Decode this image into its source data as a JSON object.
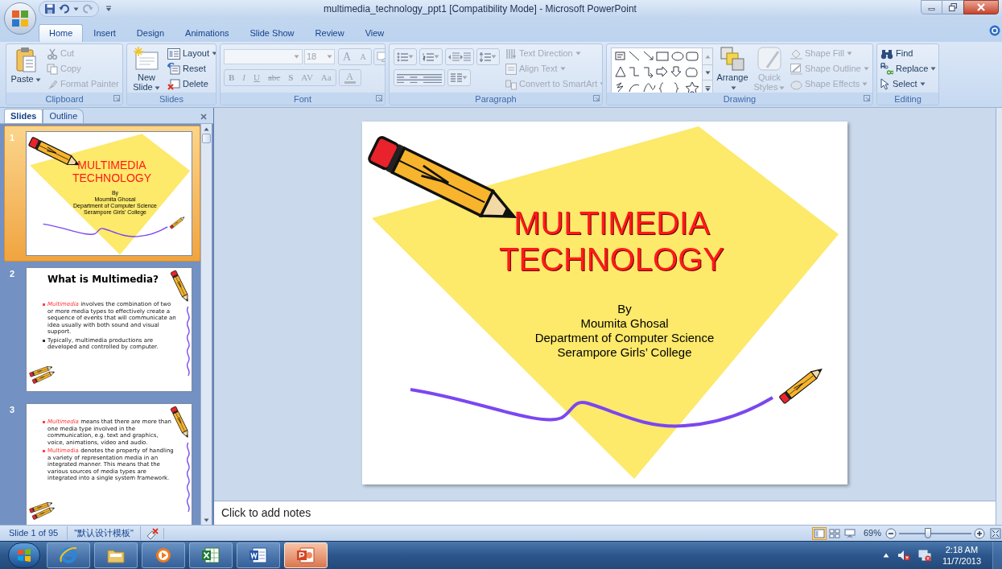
{
  "window": {
    "title": "multimedia_technology_ppt1 [Compatibility Mode] - Microsoft PowerPoint"
  },
  "tabs": [
    {
      "label": "Home",
      "selected": true
    },
    {
      "label": "Insert",
      "selected": false
    },
    {
      "label": "Design",
      "selected": false
    },
    {
      "label": "Animations",
      "selected": false
    },
    {
      "label": "Slide Show",
      "selected": false
    },
    {
      "label": "Review",
      "selected": false
    },
    {
      "label": "View",
      "selected": false
    }
  ],
  "ribbon": [
    {
      "name": "Clipboard",
      "launcher": true,
      "items": [
        {
          "kind": "large",
          "label": "Paste",
          "dropdown": true,
          "disabled": false
        },
        {
          "kind": "small",
          "label": "Cut",
          "dropdown": false,
          "disabled": true
        },
        {
          "kind": "small",
          "label": "Copy",
          "dropdown": false,
          "disabled": true
        },
        {
          "kind": "small",
          "label": "Format Painter",
          "dropdown": false,
          "disabled": true
        }
      ]
    },
    {
      "name": "Slides",
      "launcher": false,
      "items": [
        {
          "kind": "large",
          "label": "New Slide",
          "dropdown": true,
          "disabled": false
        },
        {
          "kind": "small",
          "label": "Layout",
          "dropdown": true,
          "disabled": false
        },
        {
          "kind": "small",
          "label": "Reset",
          "dropdown": false,
          "disabled": false
        },
        {
          "kind": "small",
          "label": "Delete",
          "dropdown": false,
          "disabled": false
        }
      ]
    },
    {
      "name": "Font",
      "launcher": true,
      "items": [
        {
          "kind": "font",
          "disabled": true,
          "size": "18",
          "grow": "A",
          "shrink": "A",
          "styles": [
            "B",
            "I",
            "U",
            "abc",
            "S",
            "AV",
            "Aa"
          ],
          "color_button": "A"
        }
      ]
    },
    {
      "name": "Paragraph",
      "launcher": true,
      "items": [
        {
          "kind": "icon_grid"
        },
        {
          "kind": "small",
          "label": "Text Direction",
          "dropdown": true,
          "disabled": true
        },
        {
          "kind": "small",
          "label": "Align Text",
          "dropdown": true,
          "disabled": true
        },
        {
          "kind": "small",
          "label": "Convert to SmartArt",
          "dropdown": true,
          "disabled": true
        }
      ]
    },
    {
      "name": "Drawing",
      "launcher": true,
      "items": [
        {
          "kind": "shape_gallery"
        },
        {
          "kind": "large",
          "label": "Arrange",
          "dropdown": true,
          "disabled": false
        },
        {
          "kind": "large",
          "label": "Quick Styles",
          "dropdown": true,
          "disabled": true
        },
        {
          "kind": "small",
          "label": "Shape Fill",
          "dropdown": true,
          "disabled": true
        },
        {
          "kind": "small",
          "label": "Shape Outline",
          "dropdown": true,
          "disabled": true
        },
        {
          "kind": "small",
          "label": "Shape Effects",
          "dropdown": true,
          "disabled": true
        }
      ]
    },
    {
      "name": "Editing",
      "launcher": false,
      "items": [
        {
          "kind": "small",
          "label": "Find",
          "dropdown": false,
          "disabled": false
        },
        {
          "kind": "small",
          "label": "Replace",
          "dropdown": true,
          "disabled": false
        },
        {
          "kind": "small",
          "label": "Select",
          "dropdown": true,
          "disabled": false
        }
      ]
    }
  ],
  "slide_panel": {
    "tabs": [
      {
        "label": "Slides",
        "selected": true
      },
      {
        "label": "Outline",
        "selected": false
      }
    ],
    "slides": [
      {
        "number": "1",
        "selected": true,
        "slide": {
          "kind": "title",
          "title_lines": [
            "MULTIMEDIA",
            "TECHNOLOGY"
          ],
          "byline": [
            "By",
            "Moumita Ghosal",
            "Department of Computer Science",
            "Serampore Girls’ College"
          ]
        }
      },
      {
        "number": "2",
        "selected": false,
        "slide": {
          "kind": "bullets",
          "title": "What is Multimedia?",
          "bullets": [
            {
              "lead": "Multimedia",
              "lead_italic": true,
              "text": "involves the combination of two or more media types to effectively create a sequence of events that will communicate an idea usually with both sound and visual support."
            },
            {
              "text": "Typically, multimedia productions are developed and controlled by computer."
            }
          ]
        }
      },
      {
        "number": "3",
        "selected": false,
        "slide": {
          "kind": "bullets",
          "bullets": [
            {
              "lead": "Multimedia",
              "lead_italic": true,
              "text": "means that there are more than one media type involved in the communication, e.g. text and graphics, voice, animations, video and audio."
            },
            {
              "lead": "Multimedia",
              "lead_italic": false,
              "text": "denotes the property of handling a variety of representation media in an integrated manner. This means that the various sources of media types are integrated into a single system framework."
            }
          ]
        }
      }
    ]
  },
  "current_slide": {
    "kind": "title",
    "title_lines": [
      "MULTIMEDIA",
      "TECHNOLOGY"
    ],
    "byline": [
      "By",
      "Moumita Ghosal",
      "Department of Computer Science",
      "Serampore Girls’ College"
    ]
  },
  "notes": {
    "placeholder": "Click to add notes"
  },
  "status_bar": {
    "slide_count": "Slide 1 of 95",
    "theme": "\"默认设计模板\"",
    "views": [
      {
        "kind": "normal",
        "selected": true
      },
      {
        "kind": "sorter",
        "selected": false
      },
      {
        "kind": "show",
        "selected": false
      }
    ],
    "zoom": "69%",
    "zoom_slider": {
      "level": 0.4
    }
  },
  "taskbar": {
    "apps": [
      {
        "kind": "browser",
        "active": false
      },
      {
        "kind": "folder",
        "active": false
      },
      {
        "kind": "media",
        "active": false
      },
      {
        "kind": "spreadsheet",
        "active": false
      },
      {
        "kind": "document",
        "active": false
      },
      {
        "kind": "presentation",
        "active": true
      }
    ],
    "time": "2:18 AM",
    "date": "11/7/2013"
  }
}
